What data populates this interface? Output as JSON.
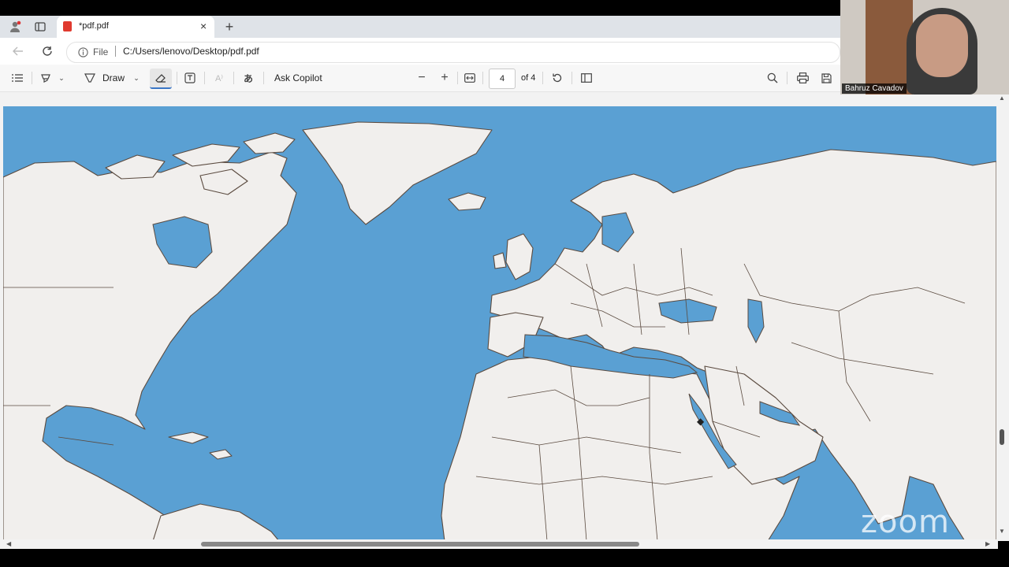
{
  "browser": {
    "tab_title": "*pdf.pdf",
    "new_tab": "+",
    "close": "×",
    "address_prefix": "File",
    "address": "C:/Users/lenovo/Desktop/pdf.pdf"
  },
  "toolbar": {
    "draw_label": "Draw",
    "copilot_label": "Ask Copilot",
    "page_current": "4",
    "page_total": "of 4"
  },
  "video": {
    "participant_name": "Bahruz Cavadov"
  },
  "watermark": "zoom",
  "colors": {
    "ocean": "#5aa0d3",
    "land": "#f1efed",
    "borders": "#5a4a3f"
  }
}
